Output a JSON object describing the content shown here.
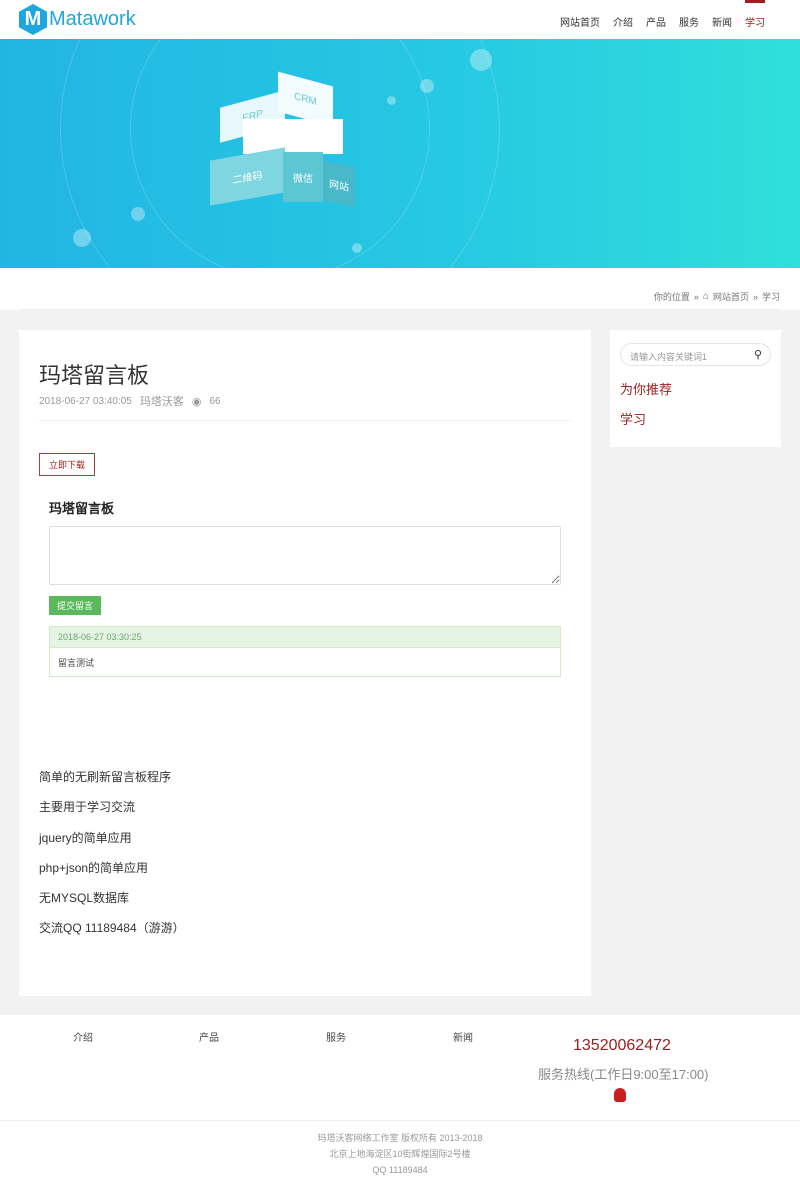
{
  "header": {
    "logo_letter": "M",
    "logo_text": "Matawork",
    "nav": [
      "网站首页",
      "介绍",
      "产品",
      "服务",
      "新闻",
      "学习"
    ],
    "active_index": 5
  },
  "banner": {
    "labels": {
      "erp": "ERP",
      "crm": "CRM",
      "qrcode": "二维码",
      "wechat": "微信",
      "website": "网站"
    }
  },
  "breadcrumb": {
    "prefix": "你的位置",
    "sep": "»",
    "home": "网站首页",
    "current": "学习"
  },
  "article": {
    "title": "玛塔留言板",
    "date": "2018-06-27 03:40:05",
    "author": "玛塔沃客",
    "views": "66",
    "download_label": "立即下载",
    "board_title": "玛塔留言板",
    "submit_label": "提交留言",
    "message": {
      "time": "2018-06-27 03:30:25",
      "text": "留言测试"
    },
    "lines": [
      "简单的无刷新留言板程序",
      "主要用于学习交流",
      "jquery的简单应用",
      "php+json的简单应用",
      "无MYSQL数据库",
      "交流QQ 11189484（游游）"
    ]
  },
  "sidebar": {
    "search_placeholder": "请输入内容关键词1",
    "recommend": "为你推荐",
    "category": "学习"
  },
  "footer": {
    "nav": [
      "介绍",
      "产品",
      "服务",
      "新闻"
    ],
    "phone": "13520062472",
    "hotline": "服务热线(工作日9:00至17:00)",
    "copyright": "玛塔沃客网络工作室 版权所有 2013-2018",
    "address": "北京上地海淀区10街辉煌国际2号楼",
    "qq": "QQ 11189484"
  },
  "colors": {
    "accent": "#a01d1d",
    "brand": "#1ea6df",
    "green": "#5cb85c"
  }
}
